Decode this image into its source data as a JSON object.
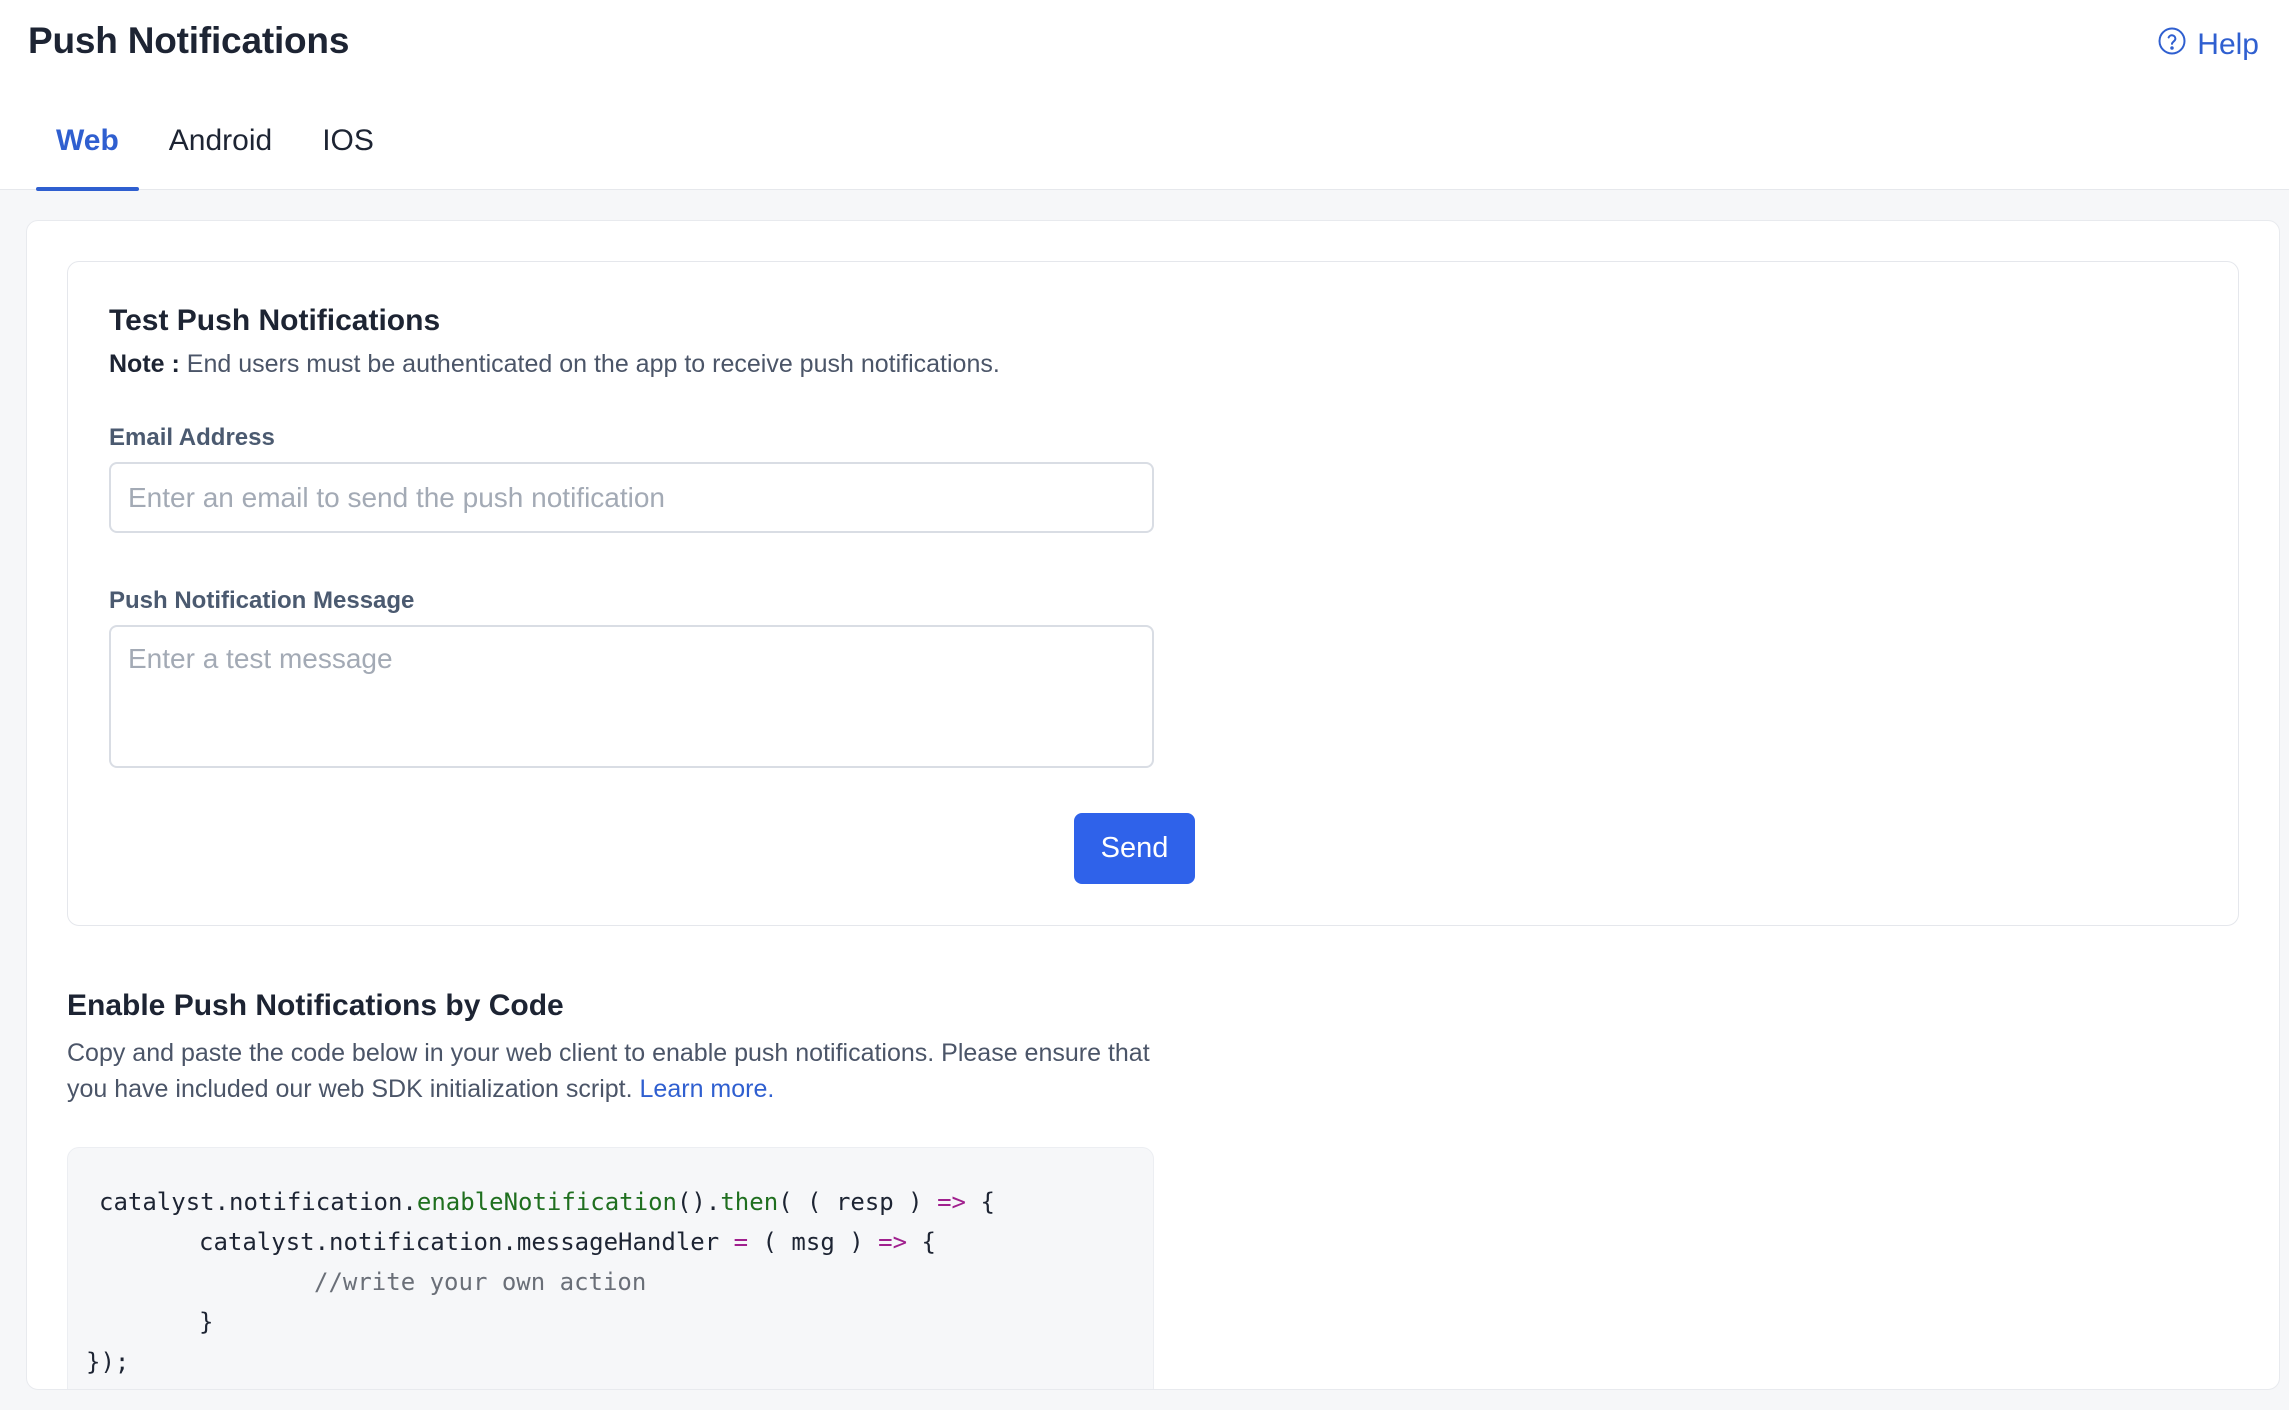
{
  "header": {
    "title": "Push Notifications",
    "help_label": "Help"
  },
  "tabs": [
    {
      "label": "Web",
      "active": true
    },
    {
      "label": "Android",
      "active": false
    },
    {
      "label": "IOS",
      "active": false
    }
  ],
  "test_section": {
    "title": "Test Push Notifications",
    "note_label": "Note :",
    "note_text": "End users must be authenticated on the app to receive push notifications.",
    "email_label": "Email Address",
    "email_placeholder": "Enter an email to send the push notification",
    "email_value": "",
    "message_label": "Push Notification Message",
    "message_placeholder": "Enter a test message",
    "message_value": "",
    "send_label": "Send"
  },
  "code_section": {
    "title": "Enable Push Notifications by Code",
    "description": "Copy and paste the code below in your web client to enable push notifications. Please ensure that you have included our web SDK initialization script.",
    "learn_more_label": "Learn more.",
    "code": {
      "l1_a": "catalyst.notification.",
      "l1_b": "enableNotification",
      "l1_c": "().",
      "l1_d": "then",
      "l1_e": "( ( resp ) ",
      "l1_f": "=>",
      "l1_g": " {",
      "l2_a": "catalyst.notification.messageHandler ",
      "l2_b": "=",
      "l2_c": " ( msg ) ",
      "l2_d": "=>",
      "l2_e": " {",
      "l3": "//write your own action",
      "l4": "}",
      "l5": "});"
    }
  },
  "colors": {
    "accent": "#2f5fd0",
    "button": "#2f62ea",
    "page_bg": "#f6f7f9"
  }
}
